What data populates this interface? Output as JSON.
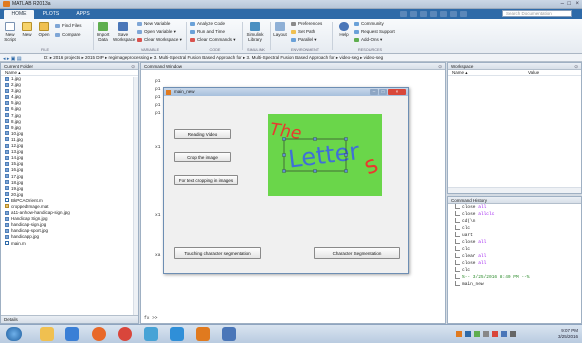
{
  "window": {
    "title": "MATLAB R2013a"
  },
  "tabs": [
    "HOME",
    "PLOTS",
    "APPS"
  ],
  "search": {
    "placeholder": "Search Documentation"
  },
  "ribbon": {
    "file": {
      "new_script": "New Script",
      "new": "New",
      "open": "Open",
      "find_files": "Find Files",
      "compare": "Compare",
      "label": "FILE"
    },
    "variable": {
      "import": "Import Data",
      "save": "Save Workspace",
      "new_variable": "New Variable",
      "open_variable": "Open Variable ▾",
      "clear_workspace": "Clear Workspace ▾",
      "label": "VARIABLE"
    },
    "code": {
      "analyze": "Analyze Code",
      "run_time": "Run and Time",
      "clear_commands": "Clear Commands ▾",
      "label": "CODE"
    },
    "simulink": {
      "library": "Simulink Library",
      "label": "SIMULINK"
    },
    "environment": {
      "layout": "Layout",
      "preferences": "Preferences",
      "set_path": "Set Path",
      "parallel": "Parallel ▾",
      "label": "ENVIRONMENT"
    },
    "resources": {
      "help": "Help",
      "community": "Community",
      "support": "Request Support",
      "addons": "Add-Ons ▾",
      "label": "RESOURCES"
    }
  },
  "address": {
    "path": "D: ▸ 2016 projects ▸ 2015 DIP ▸ regimageprocessing ▸ 3. Multi-Spectral Fusion Based Approach for ▸ 3. Multi-Spectral Fusion Based Approach for ▸ video-seg ▸ video-seg"
  },
  "folder": {
    "title": "Current Folder",
    "column": "Name ▴",
    "files": [
      "1.jpg",
      "2.jpg",
      "3.jpg",
      "4.jpg",
      "5.jpg",
      "6.jpg",
      "7.jpg",
      "8.jpg",
      "9.jpg",
      "10.jpg",
      "11.jpg",
      "12.jpg",
      "13.jpg",
      "14.jpg",
      "15.jpg",
      "16.jpg",
      "17.jpg",
      "18.jpg",
      "19.jpg",
      "20.jpg",
      "BkPCAOrient.m",
      "croppedImage.mat",
      "a11-anhow-handicap-sign.jpg",
      "Handicap Sign.jpg",
      "handicap-sign.jpg",
      "handicap-sport.jpg",
      "handicapp.jpg",
      "main.m"
    ],
    "details": "Details"
  },
  "command": {
    "title": "Command Window",
    "left_fragments": [
      "p1",
      "p1",
      "p1",
      "p1",
      "p1",
      "x1",
      "x1",
      "xa"
    ],
    "prompt": "fx >>"
  },
  "figure": {
    "title": "main_new",
    "buttons": {
      "reading": "Reading Video",
      "crop": "Crop the image",
      "text_crop": "For text cropping in images",
      "touching": "Touching character segmentation",
      "character": "Character Segmentation"
    },
    "image_words": {
      "the": "The",
      "letter": "Letter",
      "s": "s"
    }
  },
  "workspace": {
    "title": "Workspace",
    "name_col": "Name ▴",
    "value_col": "Value"
  },
  "history": {
    "title": "Command History",
    "entries": [
      "close all",
      "close allclc",
      "cd(\\n",
      "clc",
      "uart",
      "close all",
      "clc",
      "clear all",
      "close all",
      "clc"
    ],
    "keywords": [
      "all",
      "allclc",
      "",
      "",
      "",
      "all",
      "",
      "all",
      "all",
      ""
    ],
    "session": "%-- 3/25/2016 8:40 PM --%",
    "last": "main_new"
  },
  "taskbar": {
    "time": "9:07 PM",
    "date": "3/25/2016"
  },
  "colors": {
    "accent": "#2e6aa8",
    "image_bg": "#6ad64a",
    "word_blue": "#3f6fd8",
    "word_red": "#e83a2e"
  }
}
